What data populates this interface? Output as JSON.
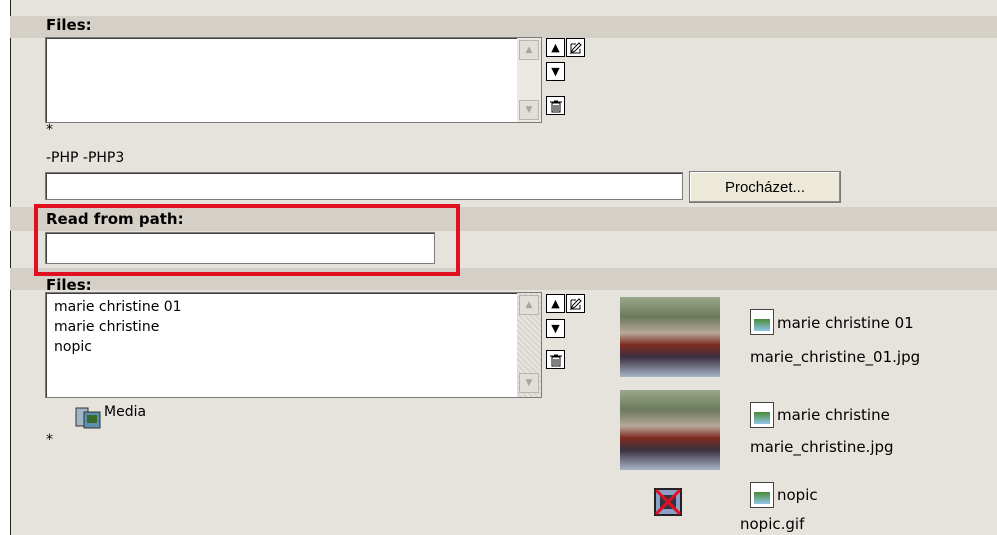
{
  "section1": {
    "label": "Files:",
    "required_mark": "*",
    "extensions_note": "-PHP -PHP3",
    "browse_label": "Procházet..."
  },
  "section2": {
    "label": "Read from path:",
    "path_value": ""
  },
  "section3": {
    "label": "Files:",
    "options": [
      "marie christine 01",
      "marie christine",
      "nopic"
    ],
    "media_label": "Media",
    "required_mark": "*"
  },
  "gallery": [
    {
      "title": "marie christine 01",
      "filename": "marie_christine_01.jpg"
    },
    {
      "title": "marie christine",
      "filename": "marie_christine.jpg"
    },
    {
      "title": "nopic",
      "filename": "nopic.gif"
    }
  ],
  "icons": {
    "up": "arrow-up-icon",
    "down": "arrow-down-icon",
    "edit": "edit-icon",
    "delete": "trash-icon",
    "media": "media-icon",
    "file": "image-file-icon",
    "broken": "broken-image-icon"
  },
  "highlight_color": "#e01020"
}
